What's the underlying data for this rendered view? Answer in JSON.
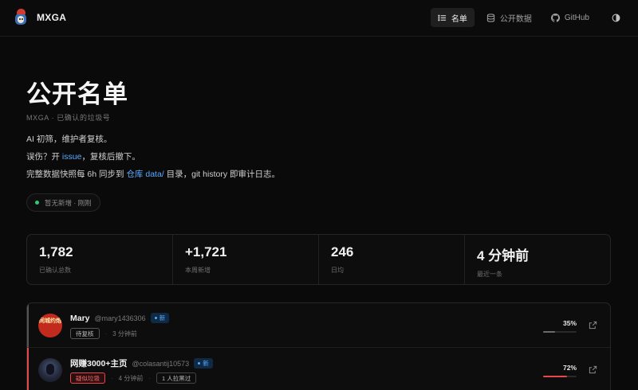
{
  "brand": {
    "name": "MXGA",
    "logo_icon": "bird-mascot-icon"
  },
  "nav": {
    "items": [
      {
        "label": "名单",
        "icon": "list-icon",
        "active": true
      },
      {
        "label": "公开数据",
        "icon": "database-icon",
        "active": false
      },
      {
        "label": "GitHub",
        "icon": "github-icon",
        "active": false
      }
    ],
    "theme_icon": "half-circle-icon"
  },
  "hero": {
    "title": "公开名单",
    "subtitle": "MXGA · 已确认的垃圾号",
    "line1": "AI 初筛，维护者复核。",
    "line2_pre": "误伤？开 ",
    "line2_link": "issue",
    "line2_post": "，复核后撤下。",
    "line3_pre": "完整数据快照每 6h 同步到 ",
    "line3_link": "仓库 data/",
    "line3_post": " 目录，git history 即审计日志。",
    "status": "暂无新增 · 刚刚"
  },
  "stats": [
    {
      "value": "1,782",
      "label": "已确认总数"
    },
    {
      "value": "+1,721",
      "label": "本周新增"
    },
    {
      "value": "246",
      "label": "日均"
    },
    {
      "value": "4 分钟前",
      "label": "最近一条"
    }
  ],
  "rows": [
    {
      "name": "Mary",
      "handle": "@mary1436306",
      "badge": "新",
      "tag": "待复核",
      "time": "3 分钟前",
      "score_label": "35%",
      "score": 0.35,
      "avatar_text": "同城约炮"
    },
    {
      "name": "网赚3000+主页",
      "handle": "@colasantij10573",
      "badge": "新",
      "tag": "疑似垃圾",
      "time": "4 分钟前",
      "reports": "1 人拉黑过",
      "score_label": "72%",
      "score": 0.72
    }
  ],
  "colors": {
    "accent": "#5aa9ff",
    "danger": "#e5484d",
    "ok": "#2ecc71"
  }
}
